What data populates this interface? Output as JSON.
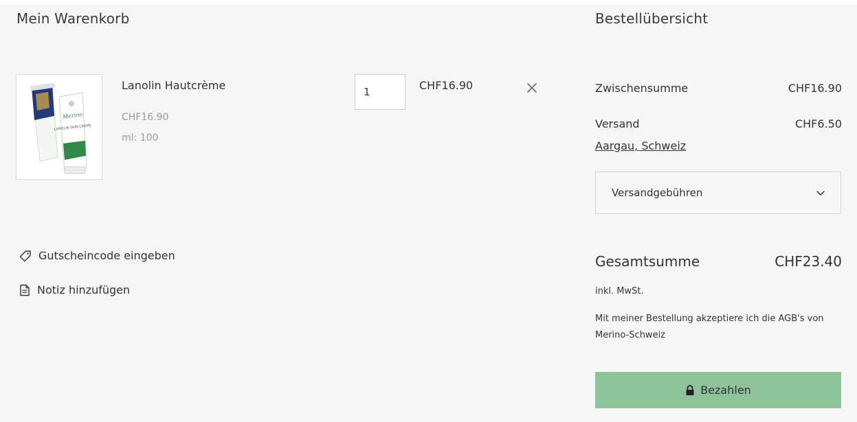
{
  "cart": {
    "title": "Mein Warenkorb",
    "item": {
      "name": "Lanolin Hautcrème",
      "unit_price": "CHF16.90",
      "option": "ml: 100",
      "quantity": "1",
      "line_total": "CHF16.90",
      "image_icon": "product-tube-image",
      "image_brand": "Merino",
      "image_product": "LANOLIN SKIN CREME"
    },
    "coupon_label": "Gutscheincode eingeben",
    "note_label": "Notiz hinzufügen"
  },
  "summary": {
    "title": "Bestellübersicht",
    "subtotal_label": "Zwischensumme",
    "subtotal_value": "CHF16.90",
    "shipping_label": "Versand",
    "shipping_value": "CHF6.50",
    "shipping_location": "Aargau, Schweiz",
    "shipping_select_label": "Versandgebühren",
    "total_label": "Gesamtsumme",
    "total_value": "CHF23.40",
    "tax_note": "inkl. MwSt.",
    "terms_note": "Mit meiner Bestellung akzeptiere ich die AGB's von Merino-Schweiz",
    "pay_label": "Bezahlen"
  },
  "colors": {
    "background": "#f6f6f6",
    "pay_button": "#8dc29b",
    "muted_text": "#9a9a9a"
  },
  "icons": {
    "remove": "close-icon",
    "coupon": "tag-icon",
    "note": "note-icon",
    "select": "chevron-down-icon",
    "pay": "lock-icon"
  }
}
